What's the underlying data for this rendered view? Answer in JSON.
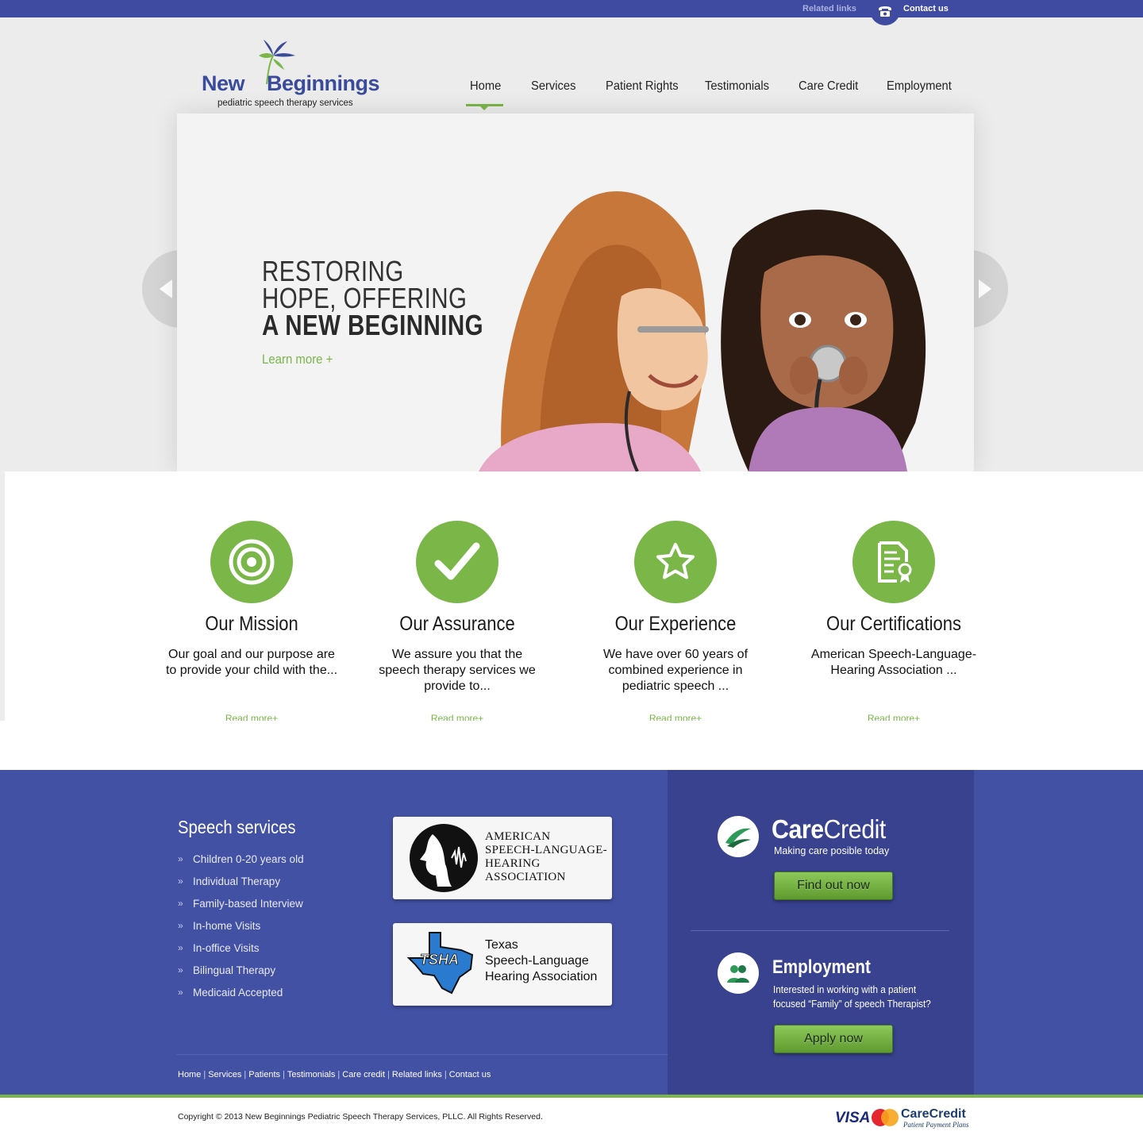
{
  "topbar": {
    "related_links": "Related links",
    "contact_us": "Contact us",
    "phone_icon": "phone-icon"
  },
  "logo": {
    "name_part1": "New",
    "name_part2": "Beginnings",
    "tagline": "pediatric speech therapy services"
  },
  "nav": {
    "items": [
      "Home",
      "Services",
      "Patient Rights",
      "Testimonials",
      "Care Credit",
      "Employment"
    ],
    "active": "Home"
  },
  "hero": {
    "line1": "RESTORING",
    "line2": "HOPE, OFFERING",
    "line3": "A NEW BEGINNING",
    "learn_more": "Learn more +"
  },
  "features": [
    {
      "icon": "target-icon",
      "title": "Our Mission",
      "text": "Our goal and our purpose are to provide your child with the...",
      "more": "Read more+"
    },
    {
      "icon": "checkmark-icon",
      "title": "Our Assurance",
      "text": "We assure you that the speech therapy services we provide to...",
      "more": "Read more+"
    },
    {
      "icon": "star-icon",
      "title": "Our Experience",
      "text": "We have over 60 years of combined experience in pediatric speech ...",
      "more": "Read more+"
    },
    {
      "icon": "certificate-icon",
      "title": "Our Certifications",
      "text": "American Speech-Language-Hearing Association ...",
      "more": "Read more+"
    }
  ],
  "services": {
    "title": "Speech services",
    "items": [
      "Children 0-20 years old",
      "Individual Therapy",
      "Family-based Interview",
      "In-home Visits",
      "In-office Visits",
      "Bilingual Therapy",
      "Medicaid Accepted"
    ]
  },
  "associations": {
    "asha": {
      "line1": "AMERICAN",
      "line2": "SPEECH-LANGUAGE-",
      "line3": "HEARING",
      "line4": "ASSOCIATION"
    },
    "tsha": {
      "badge": "TSHA",
      "line1": "Texas",
      "line2": "Speech-Language",
      "line3": "Hearing Association"
    }
  },
  "carecredit": {
    "brand_bold": "Care",
    "brand_light": "Credit",
    "subtitle": "Making care posible today",
    "button": "Find out now"
  },
  "employment": {
    "title": "Employment",
    "text": "Interested in working with a patient focused “Family” of speech Therapist?",
    "button": "Apply now"
  },
  "footer_links": [
    "Home",
    "Services",
    "Patients",
    "Testimonials",
    "Care credit",
    "Related links",
    "Contact us"
  ],
  "copyright": "Copyright © 2013 New Beginnings Pediatric Speech Therapy Services, PLLC. All Rights Reserved.",
  "payments": {
    "visa": "VISA",
    "mastercard": "MasterCard",
    "carecredit": "CareCredit",
    "carecredit_sub": "Patient Payment Plans"
  },
  "colors": {
    "brand_blue": "#3f4aa1",
    "accent_green": "#7ab648",
    "footer_blue": "#4251a3"
  }
}
